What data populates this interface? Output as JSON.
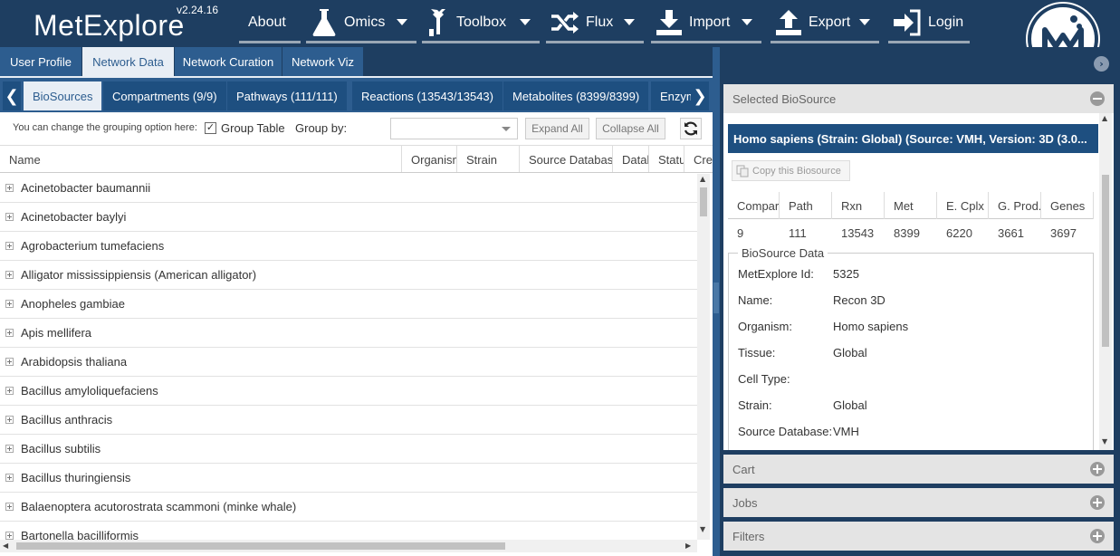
{
  "app": {
    "title": "MetExplore",
    "version": "v2.24.16"
  },
  "menu": [
    {
      "label": "About",
      "icon": "none"
    },
    {
      "label": "Omics",
      "icon": "flask-icon"
    },
    {
      "label": "Toolbox",
      "icon": "toolbox-icon"
    },
    {
      "label": "Flux",
      "icon": "shuffle-icon"
    },
    {
      "label": "Import",
      "icon": "download-icon"
    },
    {
      "label": "Export",
      "icon": "upload-icon"
    },
    {
      "label": "Login",
      "icon": "login-icon"
    }
  ],
  "main_tabs": [
    "User Profile",
    "Network Data",
    "Network Curation",
    "Network Viz"
  ],
  "sub_tabs": [
    "BioSources",
    "Compartments (9/9)",
    "Pathways (111/111)",
    "Reactions (13543/13543)",
    "Metabolites (8399/8399)",
    "Enzym"
  ],
  "toolbar": {
    "hint": "You can change the grouping option here:",
    "group_table": "Group Table",
    "group_by": "Group by:",
    "group_by_value": "",
    "expand_all": "Expand All",
    "collapse_all": "Collapse All"
  },
  "grid": {
    "columns": [
      "Name",
      "Organism",
      "Strain",
      "Source Database",
      "Datab",
      "Status",
      "Crea"
    ],
    "rows": [
      "Acinetobacter baumannii",
      "Acinetobacter baylyi",
      "Agrobacterium tumefaciens",
      "Alligator mississippiensis (American alligator)",
      "Anopheles gambiae",
      "Apis mellifera",
      "Arabidopsis thaliana",
      "Bacillus amyloliquefaciens",
      "Bacillus anthracis",
      "Bacillus subtilis",
      "Bacillus thuringiensis",
      "Balaenoptera acutorostrata scammoni (minke whale)",
      "Bartonella bacilliformis"
    ]
  },
  "right": {
    "selected_header": "Selected BioSource",
    "biosource_title": "Homo sapiens (Strain: Global) (Source: VMH, Version: 3D (3.0...",
    "copy_button": "Copy this Biosource",
    "stats_headers": [
      "Compart",
      "Path",
      "Rxn",
      "Met",
      "E. Cplx",
      "G. Prod..",
      "Genes"
    ],
    "stats_values": [
      "9",
      "111",
      "13543",
      "8399",
      "6220",
      "3661",
      "3697"
    ],
    "biosource_data_legend": "BioSource Data",
    "fields": [
      {
        "key": "MetExplore Id:",
        "value": "5325"
      },
      {
        "key": "Name:",
        "value": "Recon 3D"
      },
      {
        "key": "Organism:",
        "value": "Homo sapiens"
      },
      {
        "key": "Tissue:",
        "value": "Global"
      },
      {
        "key": "Cell Type:",
        "value": ""
      },
      {
        "key": "Strain:",
        "value": "Global"
      },
      {
        "key": "Source Database:",
        "value": "VMH"
      }
    ],
    "cart": "Cart",
    "jobs": "Jobs",
    "filters": "Filters"
  },
  "colors": {
    "header_bg": "#1e3e61",
    "tab_bg": "#2d5d8f",
    "title_bar": "#1e4f80"
  }
}
